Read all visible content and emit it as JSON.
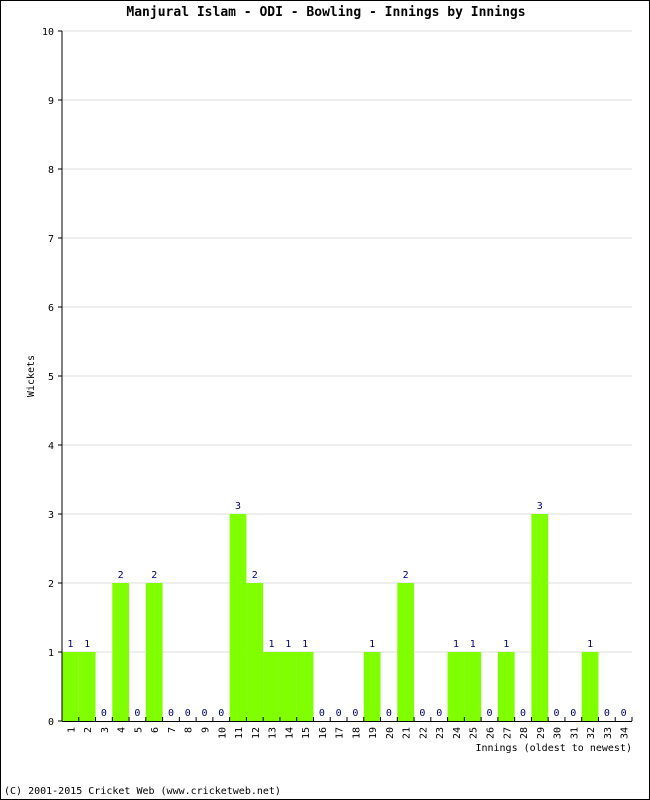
{
  "chart_data": {
    "type": "bar",
    "title": "Manjural Islam - ODI - Bowling - Innings by Innings",
    "xlabel": "Innings (oldest to newest)",
    "ylabel": "Wickets",
    "ylim": [
      0,
      10
    ],
    "yticks": [
      0,
      1,
      2,
      3,
      4,
      5,
      6,
      7,
      8,
      9,
      10
    ],
    "grid": true,
    "bar_color": "#7fff00",
    "label_color": "#000080",
    "categories": [
      "1",
      "2",
      "3",
      "4",
      "5",
      "6",
      "7",
      "8",
      "9",
      "10",
      "11",
      "12",
      "13",
      "14",
      "15",
      "16",
      "17",
      "18",
      "19",
      "20",
      "21",
      "22",
      "23",
      "24",
      "25",
      "26",
      "27",
      "28",
      "29",
      "30",
      "31",
      "32",
      "33",
      "34"
    ],
    "values": [
      1,
      1,
      0,
      2,
      0,
      2,
      0,
      0,
      0,
      0,
      3,
      2,
      1,
      1,
      1,
      0,
      0,
      0,
      1,
      0,
      2,
      0,
      0,
      1,
      1,
      0,
      1,
      0,
      3,
      0,
      0,
      1,
      0,
      0
    ]
  },
  "footer": "(C) 2001-2015 Cricket Web (www.cricketweb.net)"
}
